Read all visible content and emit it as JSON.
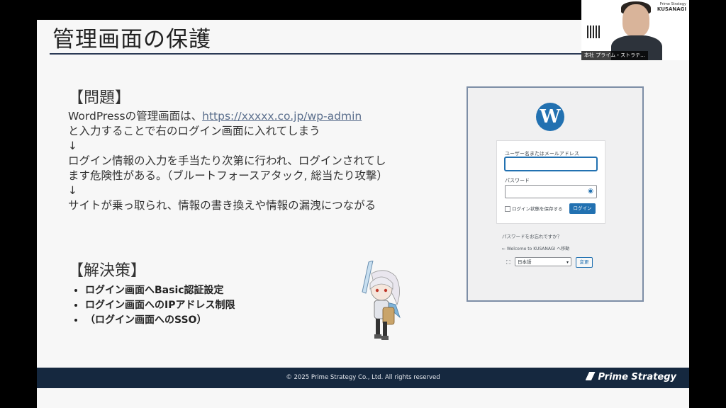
{
  "slide": {
    "title": "管理画面の保護",
    "problem_heading": "【問題】",
    "problem_line1_pre": "WordPressの管理画面は、",
    "problem_link": "https://xxxxx.co.jp/wp-admin",
    "problem_line2": "と入力することで右のログイン画面に入れてしまう",
    "arrow1": "↓",
    "problem_line3": "ログイン情報の入力を手当たり次第に行われ、ログインされてし",
    "problem_line4": "ます危険性がある。（ブルートフォースアタック, 総当たり攻撃）",
    "arrow2": "↓",
    "problem_line5": "サイトが乗っ取られ、情報の書き換えや情報の漏洩につながる",
    "solution_heading": "【解決策】",
    "solutions": [
      "ログイン画面へBasic認証設定",
      "ログイン画面へのIPアドレス制限",
      "（ログイン画面へのSSO）"
    ]
  },
  "login": {
    "logo_letter": "W",
    "username_label": "ユーザー名またはメールアドレス",
    "password_label": "パスワード",
    "remember_label": "ログイン状態を保存する",
    "login_button": "ログイン",
    "lost_password": "パスワードをお忘れですか？",
    "back_link": "← Welcome to KUSANAGI へ移動",
    "language_value": "日本語",
    "change_button": "変更"
  },
  "footer": {
    "copyright": "© 2025 Prime Strategy Co., Ltd. All rights reserved",
    "brand": "Prime Strategy"
  },
  "webcam": {
    "name_tag": "本社 プライム・ストラテ...",
    "logo_top": "Prime Strategy",
    "logo_main": "KUSANAGI"
  },
  "colors": {
    "footer_bg": "#15283f",
    "wp_blue": "#2271b1",
    "title_rule": "#2b3a55"
  }
}
